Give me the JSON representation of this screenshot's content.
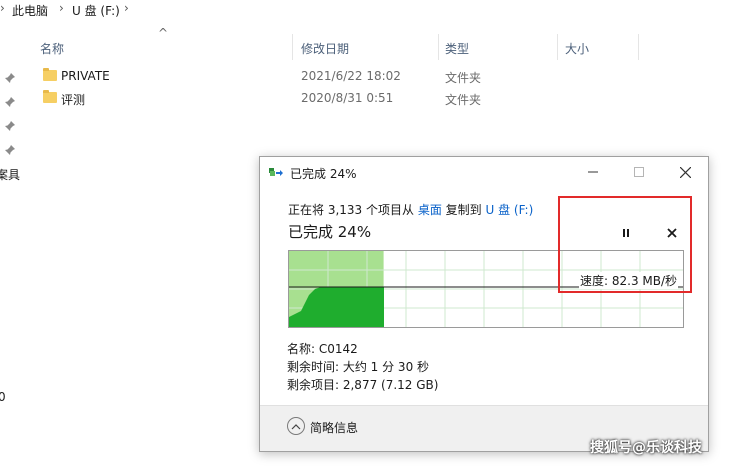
{
  "explorer": {
    "breadcrumb": [
      "此电脑",
      "U 盘 (F:)"
    ],
    "columns": {
      "name": "名称",
      "modified": "修改日期",
      "type": "类型",
      "size": "大小"
    },
    "files": [
      {
        "name": "PRIVATE",
        "modified": "2021/6/22 18:02",
        "type": "文件夹"
      },
      {
        "name": "评测",
        "modified": "2020/8/31 0:51",
        "type": "文件夹"
      }
    ],
    "left_cut_labels": [
      "案具",
      "0"
    ]
  },
  "dialog": {
    "title": "已完成 24%",
    "status": {
      "prefix": "正在将 3,133 个项目从 ",
      "source": "桌面",
      "middle": " 复制到 ",
      "destination": "U 盘 (F:)"
    },
    "progress_text": "已完成 24%",
    "progress_percent": 24,
    "speed": "速度: 82.3 MB/秒",
    "details": {
      "name": "名称: C0142",
      "time_remaining": "剩余时间: 大约 1 分 30 秒",
      "items_remaining": "剩余项目: 2,877 (7.12 GB)"
    },
    "footer_label": "简略信息",
    "colors": {
      "graph_fill_light": "#a8e090",
      "graph_fill_dark": "#1fad2e",
      "graph_grid": "#cfe8cf",
      "link": "#0a62c9"
    }
  },
  "watermark": "搜狐号@乐谈科技"
}
